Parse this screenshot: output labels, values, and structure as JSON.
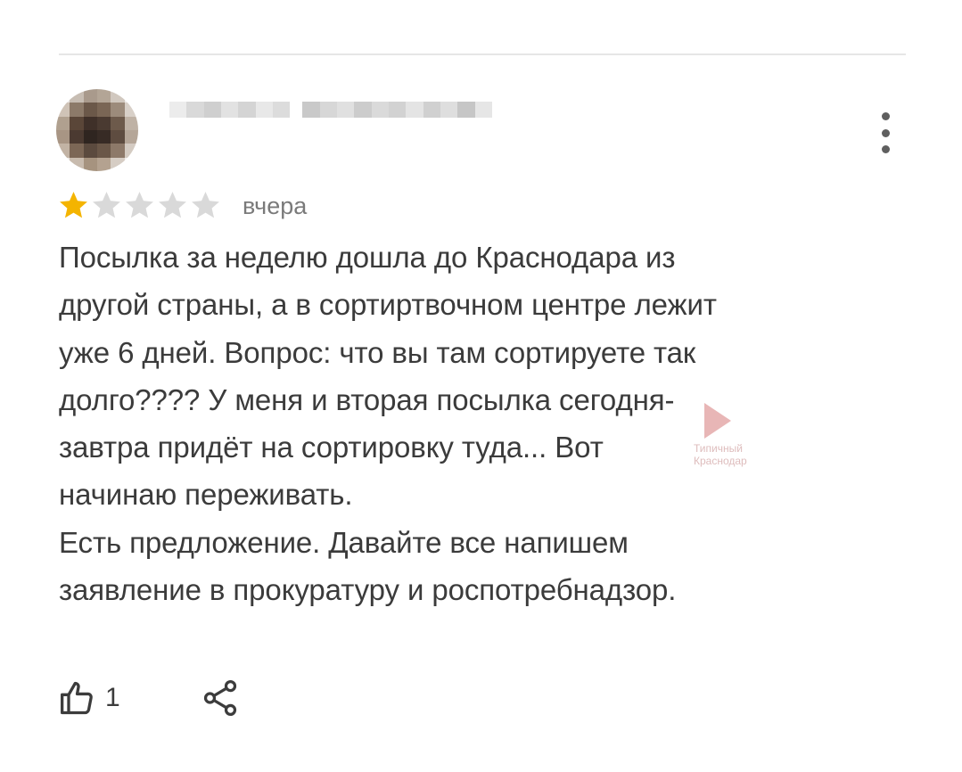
{
  "review": {
    "author": {
      "name_blurred": true
    },
    "rating": {
      "value": 1,
      "max": 5,
      "filled_color": "#f4b400",
      "empty_color": "#d9d9d9"
    },
    "date": "вчера",
    "text_lines": [
      "Посылка за неделю дошла до Краснодара из",
      "другой страны, а в сортиртвочном центре лежит",
      "уже 6 дней. Вопрос: что вы там сортируете так",
      "долго???? У меня и вторая посылка сегодня-",
      "завтра придёт на сортировку туда... Вот",
      "начинаю переживать.",
      "Есть предложение. Давайте все напишем",
      "заявление в прокуратуру и роспотребнадзор."
    ],
    "likes": "1"
  },
  "watermark": {
    "line1": "Типичный",
    "line2": "Краснодар"
  },
  "icons": {
    "menu": "more-vert-icon",
    "like": "thumbs-up-icon",
    "share": "share-icon"
  }
}
